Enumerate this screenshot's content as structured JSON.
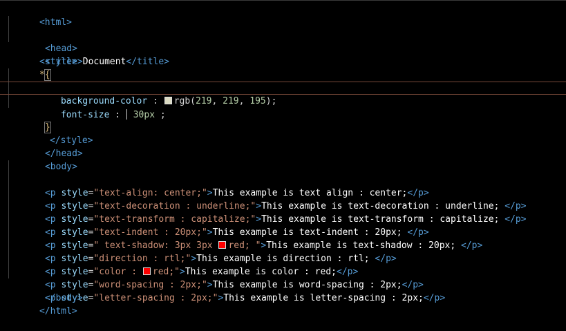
{
  "lines": {
    "l1": "<html>",
    "l2": "<head>",
    "l3a": "<title>",
    "l3b": "Document",
    "l3c": "</title>",
    "l4": "<style>",
    "l5a": "*",
    "l5b": "{",
    "l6a": "background-color",
    "l6b": " : ",
    "l6c": "rgb(",
    "l6d": "219",
    "l6e": ", ",
    "l6f": "219",
    "l6g": ", ",
    "l6h": "195",
    "l6i": ");",
    "l7a": "font-size",
    "l7b": " : ",
    "l7c": "30px",
    "l7d": " ;",
    "l9": "}",
    "l10": "</style>",
    "l11": "</head>",
    "l12": "<body>",
    "p1a": "<p ",
    "p1b": "style",
    "p1c": "=",
    "p1d": "\"text-align: center;\"",
    "p1e": ">",
    "p1f": "This example is text align : center;",
    "p1g": "</p>",
    "p2a": "<p ",
    "p2b": "style",
    "p2c": "=",
    "p2d": "\"text-decoration : underline;\"",
    "p2e": ">",
    "p2f": "This example is text-decoration : underline; ",
    "p2g": "</p>",
    "p3a": "<p ",
    "p3b": "style",
    "p3c": "=",
    "p3d": "\"text-transform : capitalize;\"",
    "p3e": ">",
    "p3f": "This example is text-transform : capitalize; ",
    "p3g": "</p>",
    "p4a": "<p ",
    "p4b": "style",
    "p4c": "=",
    "p4d": "\"text-indent : 20px;\"",
    "p4e": ">",
    "p4f": "This example is text-indent : 20px; ",
    "p4g": "</p>",
    "p5a": "<p ",
    "p5b": "style",
    "p5c": "=",
    "p5d1": "\" text-shadow: 3px 3px ",
    "p5d2": "red; \"",
    "p5e": ">",
    "p5f": "This example is text-shadow : 20px; ",
    "p5g": "</p>",
    "p6a": "<p ",
    "p6b": "style",
    "p6c": "=",
    "p6d": "\"direction : rtl;\"",
    "p6e": ">",
    "p6f": "This example is direction : rtl; ",
    "p6g": "</p>",
    "p7a": "<p ",
    "p7b": "style",
    "p7c": "=",
    "p7d1": "\"color : ",
    "p7d2": "red;\"",
    "p7e": ">",
    "p7f": "This example is color : red;",
    "p7g": "</p>",
    "p8a": "<p ",
    "p8b": "style",
    "p8c": "=",
    "p8d": "\"word-spacing : 2px;\"",
    "p8e": ">",
    "p8f": "This example is word-spacing : 2px;",
    "p8g": "</p>",
    "p9a": "<p ",
    "p9b": "style",
    "p9c": "=",
    "p9d": "\"letter-spacing : 2px;\"",
    "p9e": ">",
    "p9f": "This example is letter-spacing : 2px;",
    "p9g": "</p>",
    "l22": "</body>",
    "l23": "</html>"
  },
  "colors": {
    "background": "#000000",
    "swatch_beige": "#dbdbc3",
    "swatch_red": "#ff0000",
    "tag": "#569cd6",
    "attribute": "#9cdcfe",
    "string": "#ce9178",
    "number": "#b5cea8"
  }
}
